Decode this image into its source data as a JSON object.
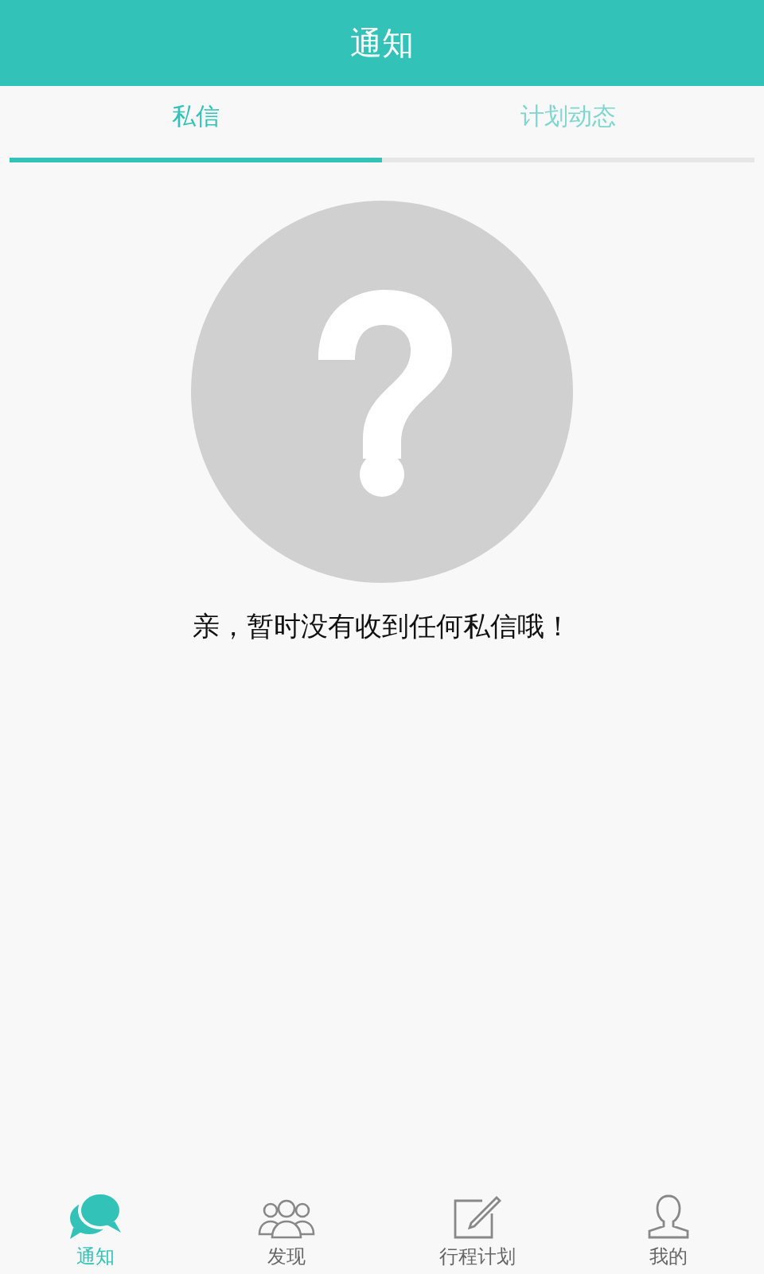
{
  "header": {
    "title": "通知"
  },
  "tabs": [
    {
      "label": "私信",
      "selected": true
    },
    {
      "label": "计划动态",
      "selected": false
    }
  ],
  "empty_state": {
    "message": "亲，暂时没有收到任何私信哦！"
  },
  "bottom_nav": [
    {
      "label": "通知",
      "kind": "chat",
      "selected": true
    },
    {
      "label": "发现",
      "kind": "people",
      "selected": false
    },
    {
      "label": "行程计划",
      "kind": "edit",
      "selected": false
    },
    {
      "label": "我的",
      "kind": "person",
      "selected": false
    }
  ]
}
